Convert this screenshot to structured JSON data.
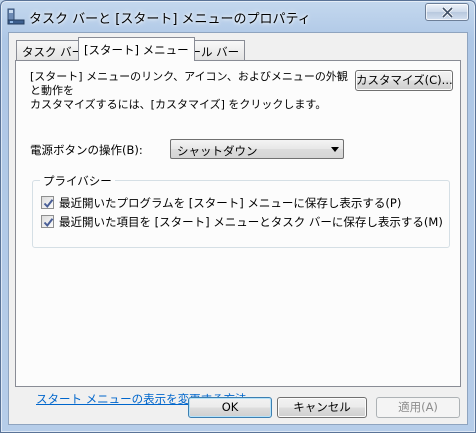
{
  "window": {
    "title": "タスク バーと [スタート] メニューのプロパティ"
  },
  "tabs": [
    {
      "label": "タスク バー",
      "active": false
    },
    {
      "label": "[スタート] メニュー",
      "active": true
    },
    {
      "label": "ツール バー",
      "active": false
    }
  ],
  "start_menu": {
    "description_line1": "[スタート] メニューのリンク、アイコン、およびメニューの外観と動作を",
    "description_line2": "カスタマイズするには、[カスタマイズ] をクリックします。",
    "customize_button": "カスタマイズ(C)...",
    "power_button_label": "電源ボタンの操作(B):",
    "power_button_value": "シャットダウン",
    "privacy": {
      "title": "プライバシー",
      "items": [
        {
          "label": "最近開いたプログラムを [スタート] メニューに保存し表示する(P)",
          "checked": true
        },
        {
          "label": "最近開いた項目を [スタート] メニューとタスク バーに保存し表示する(M)",
          "checked": true
        }
      ]
    },
    "help_link": "スタート メニューの表示を変更する方法"
  },
  "footer": {
    "ok": "OK",
    "cancel": "キャンセル",
    "apply": "適用(A)"
  },
  "colors": {
    "frame": "#b6cde9",
    "client": "#f0f0f0",
    "link": "#0066cc",
    "default_button_border": "#3c7fb1"
  }
}
